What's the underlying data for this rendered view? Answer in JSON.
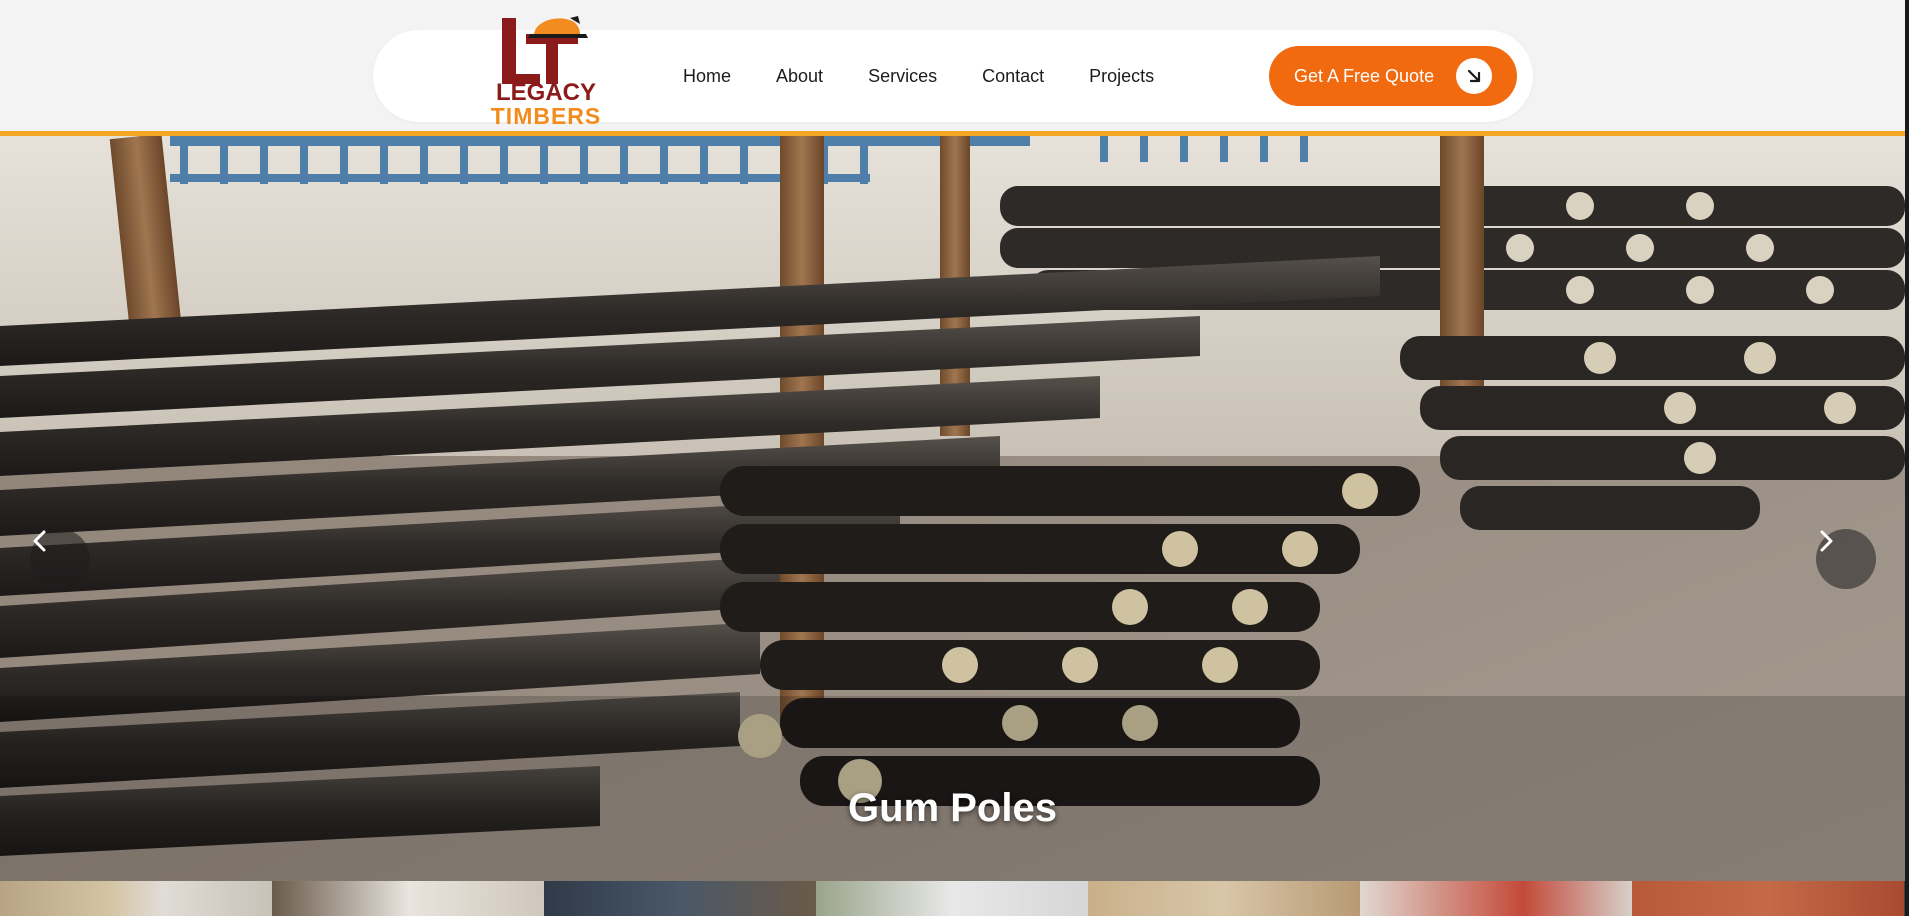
{
  "brand": {
    "logo_line1": "LEGACY",
    "logo_line2": "TIMBERS",
    "logo_monogram": "LT",
    "colors": {
      "dark_red": "#8b1a1a",
      "orange": "#f28c1e"
    }
  },
  "nav": {
    "links": [
      "Home",
      "About",
      "Services",
      "Contact",
      "Projects"
    ]
  },
  "cta": {
    "label": "Get A Free Quote",
    "icon": "arrow-down-right-icon",
    "color": "#f26a10"
  },
  "accent_color": "#f5a623",
  "hero": {
    "caption": "Gum Poles",
    "prev_icon": "chevron-left-icon",
    "next_icon": "chevron-right-icon"
  },
  "thumbnails": [
    {
      "name": "thumb-1"
    },
    {
      "name": "thumb-2"
    },
    {
      "name": "thumb-3"
    },
    {
      "name": "thumb-4"
    },
    {
      "name": "thumb-5"
    },
    {
      "name": "thumb-6"
    },
    {
      "name": "thumb-7"
    }
  ]
}
